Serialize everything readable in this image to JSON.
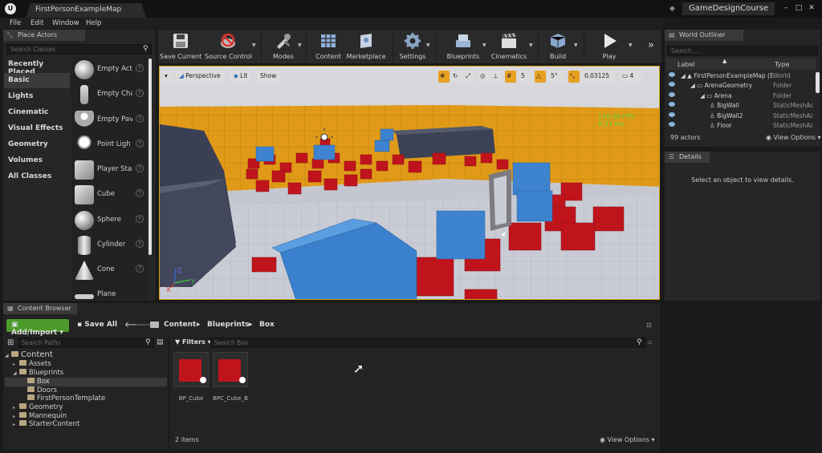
{
  "window": {
    "doc_tab": "FirstPersonExampleMap",
    "project_name": "GameDesignCourse"
  },
  "menu": [
    "File",
    "Edit",
    "Window",
    "Help"
  ],
  "place_actors": {
    "tab_label": "Place Actors",
    "search_placeholder": "Search Classes",
    "categories": [
      "Recently Placed",
      "Basic",
      "Lights",
      "Cinematic",
      "Visual Effects",
      "Geometry",
      "Volumes",
      "All Classes"
    ],
    "active_category": "Basic",
    "actors": [
      "Empty Act",
      "Empty Cha",
      "Empty Pav",
      "Point Ligh",
      "Player Star",
      "Cube",
      "Sphere",
      "Cylinder",
      "Cone",
      "Plane"
    ]
  },
  "toolbar": {
    "buttons": [
      "Save Current",
      "Source Control",
      "Modes",
      "Content",
      "Marketplace",
      "Settings",
      "Blueprints",
      "Cinematics",
      "Build",
      "Play"
    ]
  },
  "viewport": {
    "perspective_label": "Perspective",
    "lit_label": "Lit",
    "show_label": "Show",
    "grid_snap": "5",
    "rotation_snap": "5°",
    "scale_snap": "0.03125",
    "camera_speed": "4",
    "fps": "120.00 FPS",
    "ms": "8.33 ms",
    "axis_z": "Z",
    "axis_x": "X",
    "axis_y": "Y"
  },
  "world_outliner": {
    "tab_label": "World Outliner",
    "search_placeholder": "Search...",
    "col_label": "Label",
    "col_type": "Type",
    "rows": [
      {
        "label": "FirstPersonExampleMap (E",
        "type": "World",
        "indent": 0
      },
      {
        "label": "ArenaGeometry",
        "type": "Folder",
        "indent": 1
      },
      {
        "label": "Arena",
        "type": "Folder",
        "indent": 2
      },
      {
        "label": "BigWall",
        "type": "StaticMeshAc",
        "indent": 3
      },
      {
        "label": "BigWall2",
        "type": "StaticMeshAc",
        "indent": 3
      },
      {
        "label": "Floor",
        "type": "StaticMeshAc",
        "indent": 3
      }
    ],
    "actor_count": "99 actors",
    "view_options": "View Options"
  },
  "details": {
    "tab_label": "Details",
    "empty_text": "Select an object to view details."
  },
  "content_browser": {
    "tab_label": "Content Browser",
    "add_import": "Add/Import",
    "save_all": "Save All",
    "path": [
      "Content",
      "Blueprints",
      "Box"
    ],
    "search_paths_placeholder": "Search Paths",
    "filters_label": "Filters",
    "search_box_placeholder": "Search Box",
    "tree": [
      {
        "label": "Content",
        "indent": 0
      },
      {
        "label": "Assets",
        "indent": 1
      },
      {
        "label": "Blueprints",
        "indent": 1
      },
      {
        "label": "Box",
        "indent": 2
      },
      {
        "label": "Doors",
        "indent": 2
      },
      {
        "label": "FirstPersonTemplate",
        "indent": 2
      },
      {
        "label": "Geometry",
        "indent": 1
      },
      {
        "label": "Mannequin",
        "indent": 1
      },
      {
        "label": "StarterContent",
        "indent": 1
      }
    ],
    "assets": [
      "BP_Cube",
      "BPC_Cube_B"
    ],
    "item_count": "2 items",
    "view_options": "View Options"
  },
  "colors": {
    "accent_orange": "#d5a21b",
    "add_green": "#4c9a2a",
    "cube_red": "#c0141c",
    "cube_blue": "#3d83cf"
  }
}
